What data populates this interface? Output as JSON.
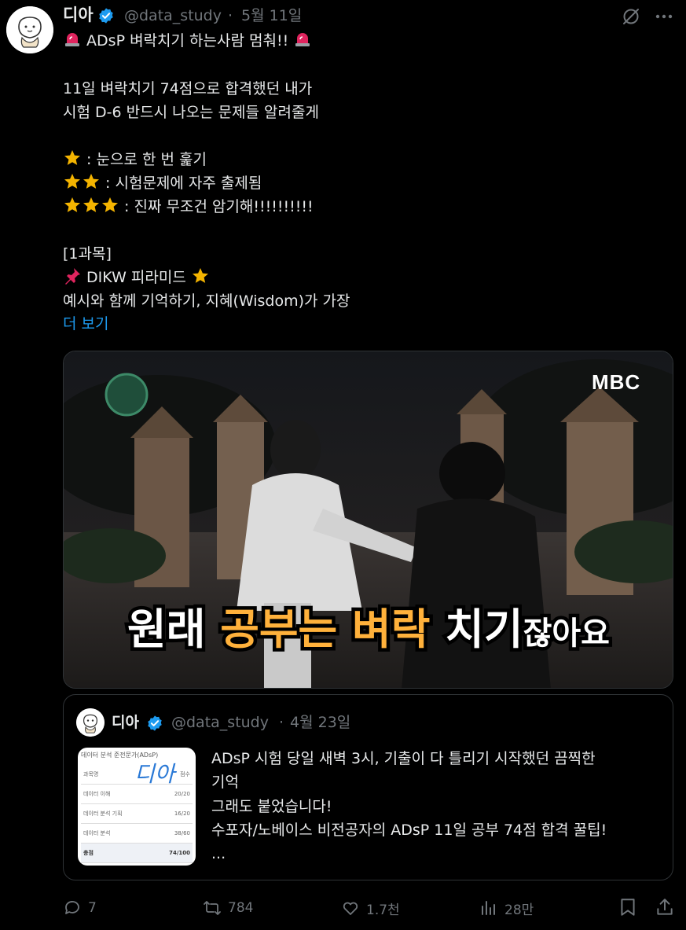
{
  "tweet": {
    "display_name": "디아",
    "handle": "@data_study",
    "separator": "·",
    "date": "5월 11일",
    "lines": [
      "ADsP 벼락치기 하는사람 멈춰!!",
      "11일 벼락치기 74점으로 합격했던 내가",
      "시험 D-6 반드시 나오는 문제들 알려줄게",
      ": 눈으로 한 번 훑기",
      ": 시험문제에 자주 출제됨",
      ": 진짜 무조건 암기해!!!!!!!!!!",
      "[1과목]",
      "DIKW 피라미드",
      "예시와 함께 기억하기, 지혜(Wisdom)가 가장"
    ],
    "show_more": "더 보기",
    "media": {
      "channel_logo": "MBC",
      "caption_parts": [
        "원래 ",
        "공부는 ",
        "벼락 ",
        "치기",
        "잖아요"
      ]
    }
  },
  "quote": {
    "display_name": "디아",
    "handle": "@data_study",
    "separator": "·",
    "date": "4월 23일",
    "lines": [
      "ADsP 시험 당일 새벽 3시, 기출이 다 틀리기 시작했던 끔찍한",
      "기억",
      "그래도 붙었습니다!",
      "수포자/노베이스 비전공자의 ADsP 11일 공부 74점 합격 꿀팁!",
      "..."
    ],
    "thumbnail": {
      "title": "데이터 분석 준전문가(ADsP)",
      "handwriting": "디아",
      "header": [
        "과목명",
        "점수"
      ],
      "rows": [
        [
          "데이터 이해",
          "20/20"
        ],
        [
          "데이터 분석 기획",
          "16/20"
        ],
        [
          "데이터 분석",
          "38/60"
        ]
      ],
      "total": [
        "총점",
        "74/100"
      ]
    }
  },
  "actions": {
    "reply_count": "7",
    "retweet_count": "784",
    "like_count": "1.7천",
    "view_count": "28만"
  },
  "colors": {
    "background": "#000000",
    "text": "#e7e9ea",
    "muted": "#71767b",
    "link": "#1d9bf0",
    "verified": "#1d9bf0",
    "star": "#f4b400",
    "siren": "#e0245e"
  }
}
